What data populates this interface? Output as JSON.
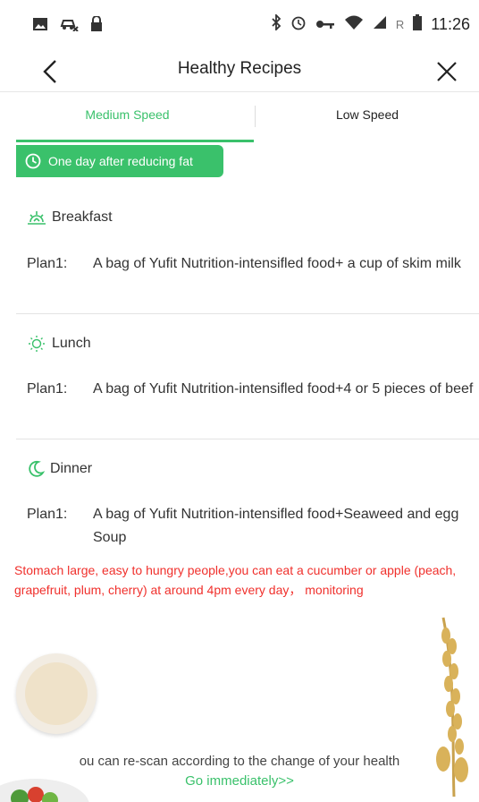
{
  "status_bar": {
    "time": "11:26",
    "network_label": "R"
  },
  "header": {
    "title": "Healthy Recipes"
  },
  "tabs": [
    {
      "label": "Medium Speed",
      "active": true
    },
    {
      "label": "Low Speed",
      "active": false
    }
  ],
  "day_pill": {
    "label": "One day after reducing fat"
  },
  "sections": [
    {
      "title": "Breakfast",
      "plan_label": "Plan1:",
      "plan_text": "A bag of Yufit Nutrition-intensifled food+ a cup of skim milk"
    },
    {
      "title": "Lunch",
      "plan_label": "Plan1:",
      "plan_text": "A bag of Yufit Nutrition-intensifled food+4 or 5 pieces of beef"
    },
    {
      "title": "Dinner",
      "plan_label": "Plan1:",
      "plan_text": "A bag of Yufit Nutrition-intensifled food+Seaweed and egg Soup"
    }
  ],
  "note": "Stomach large, easy to hungry people,you can eat a cucumber or apple (peach, grapefruit, plum, cherry) at around 4pm every day， monitoring",
  "footer": {
    "text": "ou can re-scan according to the change of your health",
    "link": "Go immediately>>"
  },
  "colors": {
    "accent": "#3ac16b",
    "warning": "#f0302c"
  }
}
